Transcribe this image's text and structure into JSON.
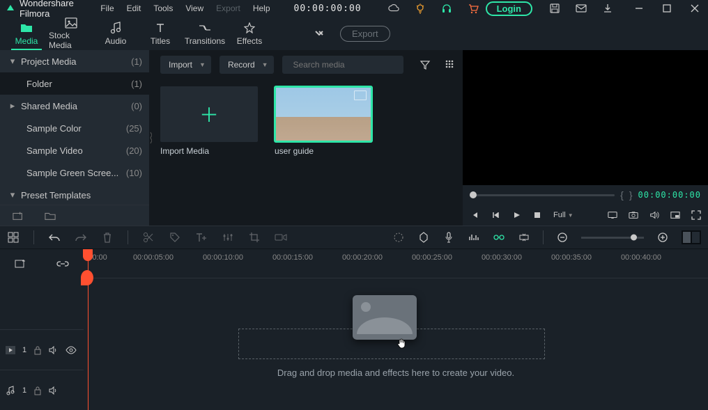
{
  "app": {
    "name": "Wondershare Filmora"
  },
  "menubar": [
    "File",
    "Edit",
    "Tools",
    "View",
    "Export",
    "Help"
  ],
  "menubar_disabled_index": 4,
  "titlebar_timecode": "00:00:00:00",
  "login_label": "Login",
  "tabs": [
    {
      "label": "Media"
    },
    {
      "label": "Stock Media"
    },
    {
      "label": "Audio"
    },
    {
      "label": "Titles"
    },
    {
      "label": "Transitions"
    },
    {
      "label": "Effects"
    }
  ],
  "active_tab_index": 0,
  "export_label": "Export",
  "sidebar": {
    "items": [
      {
        "arrow": "down",
        "label": "Project Media",
        "count": "(1)"
      },
      {
        "arrow": "",
        "label": "Folder",
        "count": "(1)",
        "indent": true,
        "selected": true
      },
      {
        "arrow": "right",
        "label": "Shared Media",
        "count": "(0)"
      },
      {
        "arrow": "",
        "label": "Sample Color",
        "count": "(25)",
        "indent": true
      },
      {
        "arrow": "",
        "label": "Sample Video",
        "count": "(20)",
        "indent": true
      },
      {
        "arrow": "",
        "label": "Sample Green Scree...",
        "count": "(10)",
        "indent": true
      },
      {
        "arrow": "down",
        "label": "Preset Templates",
        "count": ""
      }
    ]
  },
  "media_toolbar": {
    "import_label": "Import",
    "record_label": "Record",
    "search_placeholder": "Search media"
  },
  "media_items": [
    {
      "caption": "Import Media",
      "type": "placeholder"
    },
    {
      "caption": "user guide",
      "type": "video",
      "selected": true
    }
  ],
  "preview": {
    "timecode": "00:00:00:00",
    "quality_label": "Full"
  },
  "timeline": {
    "ticks": [
      "00:00",
      "00:00:05:00",
      "00:00:10:00",
      "00:00:15:00",
      "00:00:20:00",
      "00:00:25:00",
      "00:00:30:00",
      "00:00:35:00",
      "00:00:40:00"
    ],
    "drop_hint": "Drag and drop media and effects here to create your video.",
    "video_track_index": "1",
    "audio_track_index": "1"
  }
}
